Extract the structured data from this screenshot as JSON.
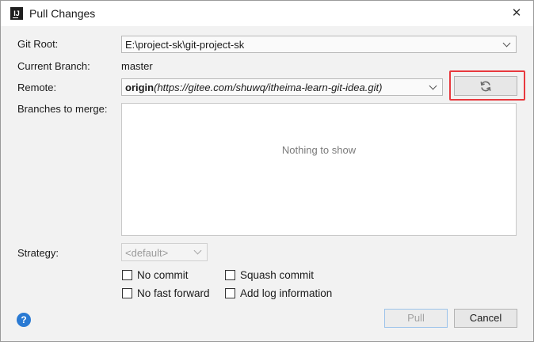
{
  "window": {
    "title": "Pull Changes",
    "app_icon_text": "IJ"
  },
  "form": {
    "git_root_label": "Git Root:",
    "git_root_value": "E:\\project-sk\\git-project-sk",
    "current_branch_label": "Current Branch:",
    "current_branch_value": "master",
    "remote_label": "Remote:",
    "remote_name": "origin",
    "remote_open_paren": "(",
    "remote_url": "https://gitee.com/shuwq/itheima-learn-git-idea.git",
    "remote_close_paren": ")",
    "branches_label": "Branches to merge:",
    "branches_empty_text": "Nothing to show",
    "strategy_label": "Strategy:",
    "strategy_value": "<default>"
  },
  "options": {
    "no_commit": "No commit",
    "squash_commit": "Squash commit",
    "no_fast_forward": "No fast forward",
    "add_log_information": "Add log information"
  },
  "buttons": {
    "pull": "Pull",
    "cancel": "Cancel",
    "help": "?"
  },
  "icons": {
    "close": "close-icon",
    "refresh": "refresh-icon",
    "help": "help-icon"
  },
  "colors": {
    "highlight_border": "#e8393e",
    "help_icon": "#2a7ad3"
  }
}
